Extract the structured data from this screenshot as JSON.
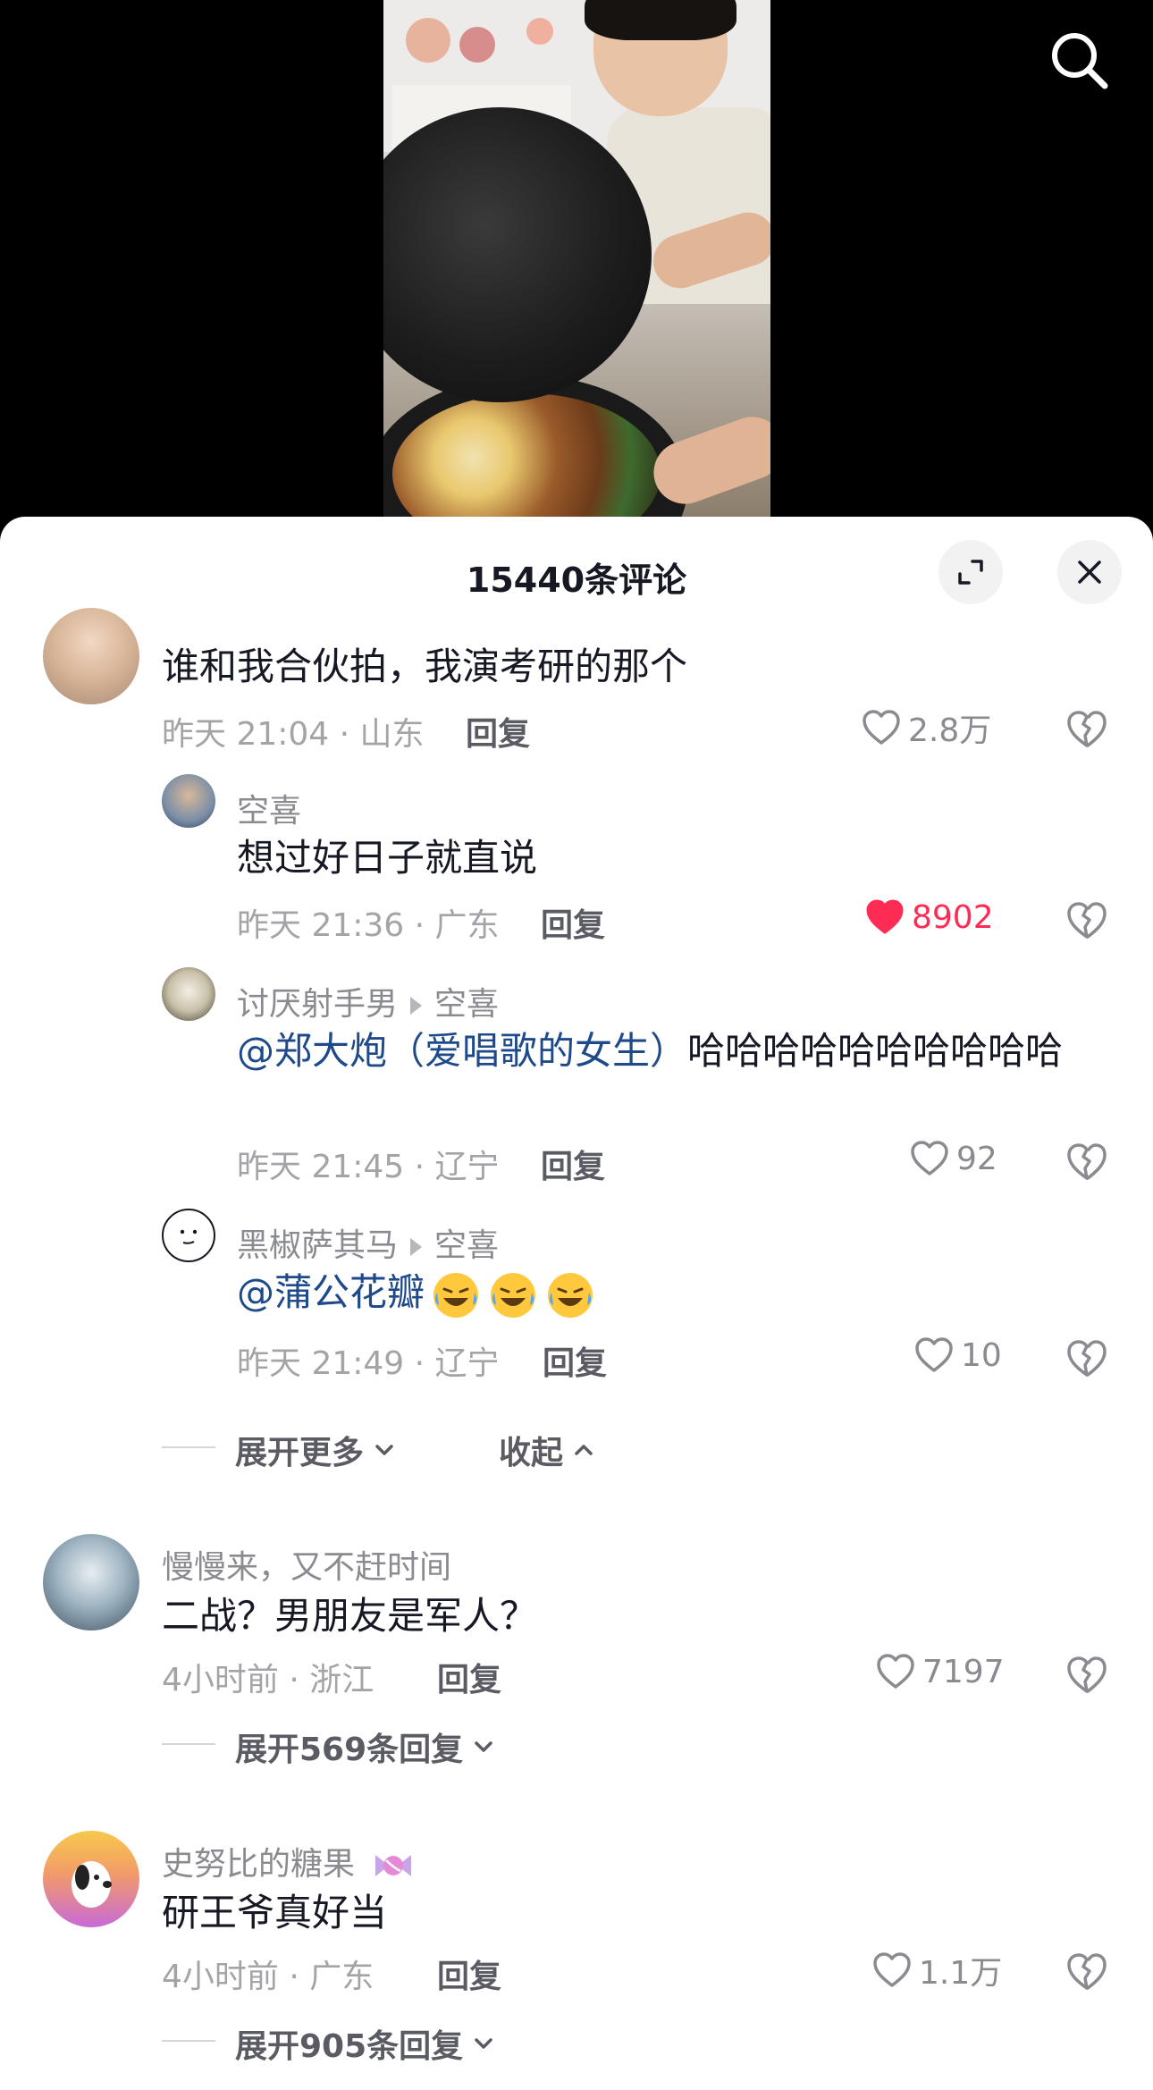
{
  "header": {
    "title": "15440条评论",
    "expand_icon": "expand-icon",
    "close_icon": "close-icon"
  },
  "top_bar": {
    "search_icon": "search-icon"
  },
  "comments": [
    {
      "user": "",
      "text": "谁和我合伙拍，我演考研的那个",
      "time": "昨天 21:04",
      "location": "山东",
      "reply": "回复",
      "likes": "2.8万",
      "liked": false,
      "replies": [
        {
          "user": "空喜",
          "reply_to": "",
          "mention": "",
          "text": "想过好日子就直说",
          "time": "昨天 21:36",
          "location": "广东",
          "reply": "回复",
          "likes": "8902",
          "liked": true
        },
        {
          "user": "讨厌射手男",
          "reply_to": "空喜",
          "mention": "@郑大炮（爱唱歌的女生）",
          "text": "哈哈哈哈哈哈哈哈哈哈",
          "time": "昨天 21:45",
          "location": "辽宁",
          "reply": "回复",
          "likes": "92",
          "liked": false
        },
        {
          "user": "黑椒萨其马",
          "reply_to": "空喜",
          "mention": "@蒲公花瓣",
          "text": "",
          "time": "昨天 21:49",
          "location": "辽宁",
          "reply": "回复",
          "likes": "10",
          "liked": false
        }
      ],
      "expand_more": "展开更多",
      "collapse": "收起"
    },
    {
      "user": "慢慢来，又不赶时间",
      "text": "二战？男朋友是军人？",
      "time": "4小时前",
      "location": "浙江",
      "reply": "回复",
      "likes": "7197",
      "liked": false,
      "expand_replies": "展开569条回复"
    },
    {
      "user": "史努比的糖果",
      "text": "研王爷真好当",
      "time": "4小时前",
      "location": "广东",
      "reply": "回复",
      "likes": "1.1万",
      "liked": false,
      "expand_replies": "展开905条回复"
    }
  ],
  "colors": {
    "like_active": "#fe2c55",
    "mention": "#1f4a8a",
    "meta": "#a3a4a8"
  }
}
